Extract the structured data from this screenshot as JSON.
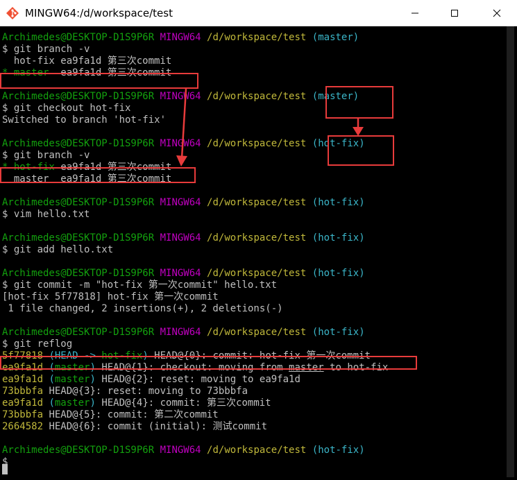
{
  "window": {
    "title": "MINGW64:/d/workspace/test",
    "buttons": {
      "minimize": "minimize-icon",
      "maximize": "maximize-icon",
      "close": "close-icon"
    }
  },
  "colors": {
    "user": "#13a10e",
    "system": "#c000c0",
    "path": "#c1b93b",
    "branch": "#3bb6c9",
    "text": "#c0c0c0",
    "highlight": "#e83b3b"
  },
  "lines": [
    [],
    [
      [
        "g",
        "Archimedes@DESKTOP-D1S9P6R"
      ],
      [
        "w",
        " "
      ],
      [
        "m",
        "MINGW64"
      ],
      [
        "w",
        " "
      ],
      [
        "y",
        "/d/workspace/test"
      ],
      [
        "w",
        " "
      ],
      [
        "c",
        "(master)"
      ]
    ],
    [
      [
        "w",
        "$ git branch -v"
      ]
    ],
    [
      [
        "w",
        "  hot-fix ea9fa1d 第三次commit"
      ]
    ],
    [
      [
        "g",
        "* master "
      ],
      [
        "w",
        " ea9fa1d 第三次commit"
      ]
    ],
    [],
    [
      [
        "g",
        "Archimedes@DESKTOP-D1S9P6R"
      ],
      [
        "w",
        " "
      ],
      [
        "m",
        "MINGW64"
      ],
      [
        "w",
        " "
      ],
      [
        "y",
        "/d/workspace/test"
      ],
      [
        "w",
        " "
      ],
      [
        "c",
        "(master)"
      ]
    ],
    [
      [
        "w",
        "$ git checkout hot-fix"
      ]
    ],
    [
      [
        "w",
        "Switched to branch 'hot-fix'"
      ]
    ],
    [],
    [
      [
        "g",
        "Archimedes@DESKTOP-D1S9P6R"
      ],
      [
        "w",
        " "
      ],
      [
        "m",
        "MINGW64"
      ],
      [
        "w",
        " "
      ],
      [
        "y",
        "/d/workspace/test"
      ],
      [
        "w",
        " "
      ],
      [
        "c",
        "(hot-fix)"
      ]
    ],
    [
      [
        "w",
        "$ git branch -v"
      ]
    ],
    [
      [
        "g",
        "* hot-fix"
      ],
      [
        "w",
        " ea9fa1d 第三次commit"
      ]
    ],
    [
      [
        "w",
        "  master  ea9fa1d 第三次commit"
      ]
    ],
    [],
    [
      [
        "g",
        "Archimedes@DESKTOP-D1S9P6R"
      ],
      [
        "w",
        " "
      ],
      [
        "m",
        "MINGW64"
      ],
      [
        "w",
        " "
      ],
      [
        "y",
        "/d/workspace/test"
      ],
      [
        "w",
        " "
      ],
      [
        "c",
        "(hot-fix)"
      ]
    ],
    [
      [
        "w",
        "$ vim hello.txt"
      ]
    ],
    [],
    [
      [
        "g",
        "Archimedes@DESKTOP-D1S9P6R"
      ],
      [
        "w",
        " "
      ],
      [
        "m",
        "MINGW64"
      ],
      [
        "w",
        " "
      ],
      [
        "y",
        "/d/workspace/test"
      ],
      [
        "w",
        " "
      ],
      [
        "c",
        "(hot-fix)"
      ]
    ],
    [
      [
        "w",
        "$ git add hello.txt"
      ]
    ],
    [],
    [
      [
        "g",
        "Archimedes@DESKTOP-D1S9P6R"
      ],
      [
        "w",
        " "
      ],
      [
        "m",
        "MINGW64"
      ],
      [
        "w",
        " "
      ],
      [
        "y",
        "/d/workspace/test"
      ],
      [
        "w",
        " "
      ],
      [
        "c",
        "(hot-fix)"
      ]
    ],
    [
      [
        "w",
        "$ git commit -m \"hot-fix 第一次commit\" hello.txt"
      ]
    ],
    [
      [
        "w",
        "[hot-fix 5f77818] hot-fix 第一次commit"
      ]
    ],
    [
      [
        "w",
        " 1 file changed, 2 insertions(+), 2 deletions(-)"
      ]
    ],
    [],
    [
      [
        "g",
        "Archimedes@DESKTOP-D1S9P6R"
      ],
      [
        "w",
        " "
      ],
      [
        "m",
        "MINGW64"
      ],
      [
        "w",
        " "
      ],
      [
        "y",
        "/d/workspace/test"
      ],
      [
        "w",
        " "
      ],
      [
        "c",
        "(hot-fix)"
      ]
    ],
    [
      [
        "w",
        "$ git reflog"
      ]
    ],
    [
      [
        "y",
        "5f77818 "
      ],
      [
        "c",
        "(HEAD -> "
      ],
      [
        "g",
        "hot-fix"
      ],
      [
        "c",
        ")"
      ],
      [
        "w",
        " HEAD@{0}: commit: hot-fix 第一次commit"
      ]
    ],
    [
      [
        "y",
        "ea9fa1d "
      ],
      [
        "c",
        "("
      ],
      [
        "g",
        "master"
      ],
      [
        "c",
        ")"
      ],
      [
        "w",
        " HEAD@{1}: checkout: moving from "
      ],
      [
        "wu",
        "master"
      ],
      [
        "w",
        " to hot-fix"
      ]
    ],
    [
      [
        "y",
        "ea9fa1d "
      ],
      [
        "c",
        "("
      ],
      [
        "g",
        "master"
      ],
      [
        "c",
        ")"
      ],
      [
        "w",
        " HEAD@{2}: reset: moving to ea9fa1d"
      ]
    ],
    [
      [
        "y",
        "73bbbfa"
      ],
      [
        "w",
        " HEAD@{3}: reset: moving to 73bbbfa"
      ]
    ],
    [
      [
        "y",
        "ea9fa1d "
      ],
      [
        "c",
        "("
      ],
      [
        "g",
        "master"
      ],
      [
        "c",
        ")"
      ],
      [
        "w",
        " HEAD@{4}: commit: 第三次commit"
      ]
    ],
    [
      [
        "y",
        "73bbbfa"
      ],
      [
        "w",
        " HEAD@{5}: commit: 第二次commit"
      ]
    ],
    [
      [
        "y",
        "2664582"
      ],
      [
        "w",
        " HEAD@{6}: commit (initial): 测试commit"
      ]
    ],
    [],
    [
      [
        "g",
        "Archimedes@DESKTOP-D1S9P6R"
      ],
      [
        "w",
        " "
      ],
      [
        "m",
        "MINGW64"
      ],
      [
        "w",
        " "
      ],
      [
        "y",
        "/d/workspace/test"
      ],
      [
        "w",
        " "
      ],
      [
        "c",
        "(hot-fix)"
      ]
    ],
    [
      [
        "w",
        "$"
      ]
    ]
  ]
}
